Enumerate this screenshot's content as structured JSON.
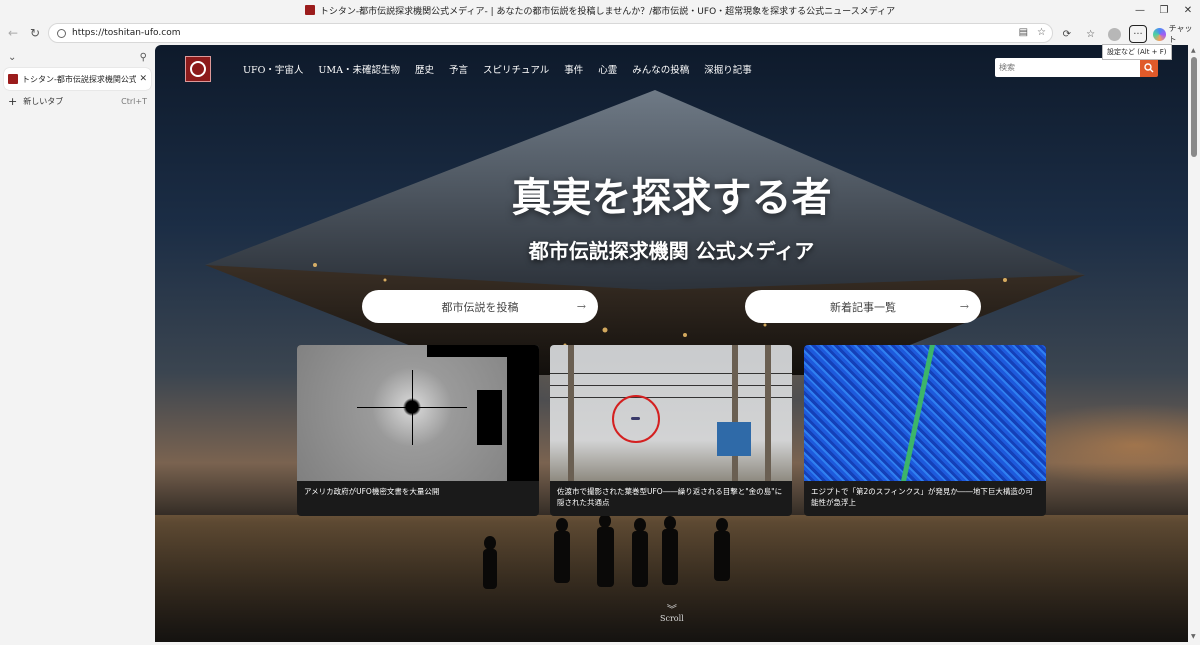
{
  "window": {
    "title": "トシタン-都市伝説探求機関公式メディア- | あなたの都市伝説を投稿しませんか？/都市伝説・UFO・超常現象を探求する公式ニュースメディア",
    "controls": [
      "—",
      "❐",
      "✕"
    ]
  },
  "toolbar": {
    "url": "https://toshitan-ufo.com",
    "copilot_label": "チャット",
    "tooltip": "設定など (Alt + F)"
  },
  "sidebar": {
    "tabs": [
      {
        "title": "トシタン-都市伝説探求機関公式メディ"
      }
    ],
    "new_tab_label": "新しいタブ",
    "new_tab_shortcut": "Ctrl+T"
  },
  "site": {
    "nav": [
      "UFO・宇宙人",
      "UMA・未確認生物",
      "歴史",
      "予言",
      "スピリチュアル",
      "事件",
      "心霊",
      "みんなの投稿",
      "深掘り記事"
    ],
    "search_placeholder": "検索",
    "hero_title": "真実を探求する者",
    "hero_subtitle": "都市伝説探求機関 公式メディア",
    "cta_left": "都市伝説を投稿",
    "cta_right": "新着記事一覧",
    "cta_arrow": "→",
    "cards": [
      {
        "caption": "アメリカ政府がUFO機密文書を大量公開"
      },
      {
        "caption": "佐渡市で撮影された葉巻型UFO――繰り返される目撃と\"金の島\"に隠された共通点"
      },
      {
        "caption": "エジプトで「第2のスフィンクス」が発見か――地下巨大構造の可能性が急浮上"
      }
    ],
    "scroll_label": "Scroll"
  },
  "colors": {
    "accent": "#e05a2a",
    "logo": "#8c1b1b"
  }
}
